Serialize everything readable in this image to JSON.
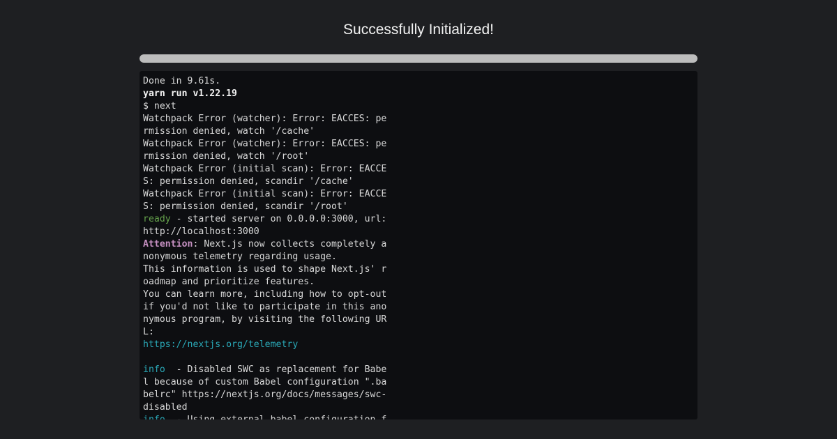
{
  "header": {
    "title": "Successfully Initialized!"
  },
  "progress": {
    "value_percent": 100
  },
  "colors": {
    "background": "#1e1f22",
    "terminal_background": "#0d0e11",
    "progress_fill": "#bdbdbd",
    "ready": "#66a34c",
    "attention": "#c690c2",
    "info": "#2aa9b8"
  },
  "terminal": {
    "lines": [
      {
        "style": "normal",
        "text": "Done in 9.61s."
      },
      {
        "style": "bold",
        "text": "yarn run v1.22.19"
      },
      {
        "style": "normal",
        "text": "$ next"
      },
      {
        "style": "normal",
        "text": "Watchpack Error (watcher): Error: EACCES: permission denied, watch '/cache'"
      },
      {
        "style": "normal",
        "text": "Watchpack Error (watcher): Error: EACCES: permission denied, watch '/root'"
      },
      {
        "style": "normal",
        "text": "Watchpack Error (initial scan): Error: EACCES: permission denied, scandir '/cache'"
      },
      {
        "style": "normal",
        "text": "Watchpack Error (initial scan): Error: EACCES: permission denied, scandir '/root'"
      },
      {
        "style": "ready",
        "prefix": "ready",
        "text": " - started server on 0.0.0.0:3000, url: http://localhost:3000"
      },
      {
        "style": "attention",
        "prefix": "Attention",
        "text": ": Next.js now collects completely anonymous telemetry regarding usage."
      },
      {
        "style": "normal",
        "text": "This information is used to shape Next.js' roadmap and prioritize features."
      },
      {
        "style": "normal",
        "text": "You can learn more, including how to opt-out if you'd not like to participate in this anonymous program, by visiting the following URL:"
      },
      {
        "style": "link",
        "text": "https://nextjs.org/telemetry"
      },
      {
        "style": "blank",
        "text": ""
      },
      {
        "style": "info",
        "prefix": "info",
        "text": "  - Disabled SWC as replacement for Babel because of custom Babel configuration \".babelrc\" https://nextjs.org/docs/messages/swc-disabled"
      },
      {
        "style": "info",
        "prefix": "info",
        "text": "  - Using external babel configuration from /app/.babelrc"
      }
    ]
  }
}
